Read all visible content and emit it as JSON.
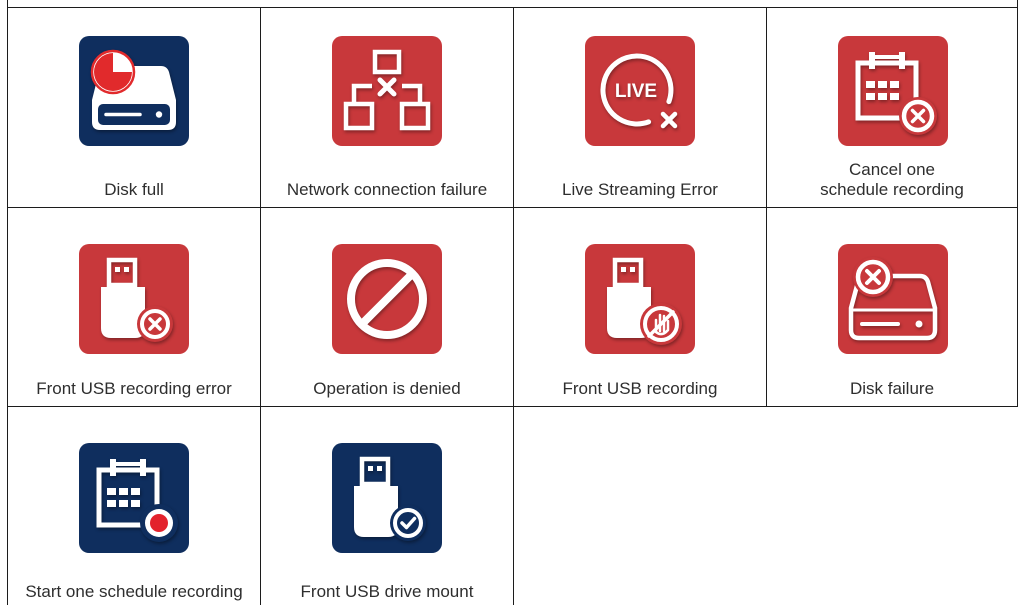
{
  "colors": {
    "border": "#1c1c1c",
    "label_text": "#2e2e2e"
  },
  "table": {
    "rows": [
      {
        "cells": [
          {
            "label": "Disk full",
            "icon": "disk-full-icon",
            "tile_color": "#0f2e5e",
            "accent_color": "#e12a2c"
          },
          {
            "label": "Network connection failure",
            "icon": "network-connection-failure-icon",
            "tile_color": "#c8383b"
          },
          {
            "label": "Live Streaming Error",
            "icon": "live-streaming-error-icon",
            "tile_color": "#c8383b",
            "icon_text": "LIVE"
          },
          {
            "label": "Cancel one\nschedule recording",
            "icon": "cancel-schedule-recording-icon",
            "tile_color": "#c8383b"
          }
        ]
      },
      {
        "cells": [
          {
            "label": "Front USB recording error",
            "icon": "usb-recording-error-icon",
            "tile_color": "#c8383b"
          },
          {
            "label": "Operation is denied",
            "icon": "operation-denied-icon",
            "tile_color": "#c8383b"
          },
          {
            "label": "Front USB recording",
            "icon": "usb-recording-blocked-icon",
            "tile_color": "#c8383b"
          },
          {
            "label": "Disk failure",
            "icon": "disk-failure-icon",
            "tile_color": "#c8383b"
          }
        ]
      },
      {
        "cells": [
          {
            "label": "Start one schedule recording",
            "icon": "start-schedule-recording-icon",
            "tile_color": "#0f2e5e",
            "accent_color": "#e3222c"
          },
          {
            "label": "Front USB drive mount",
            "icon": "usb-drive-mount-icon",
            "tile_color": "#0f2e5e"
          }
        ]
      }
    ]
  }
}
